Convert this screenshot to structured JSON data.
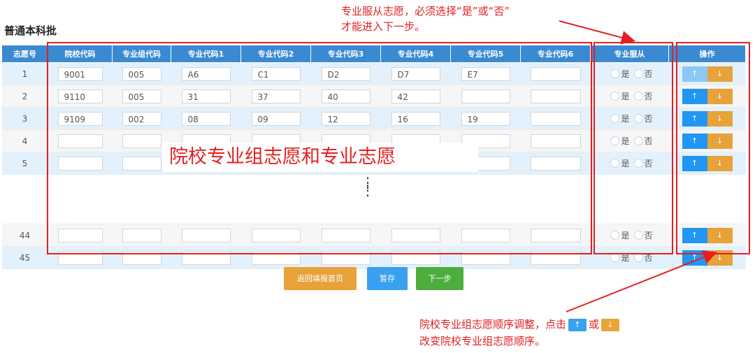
{
  "page": {
    "title": "普通本科批"
  },
  "annotations": {
    "top_line1": "专业服从志愿，必须选择“是”或“否”",
    "top_line2": "才能进入下一步。",
    "bottom_line1_part1": "院校专业组志愿顺序调整，点击",
    "bottom_line1_part2": "或",
    "bottom_line2": "改变院校专业组志愿顺序。",
    "overlay": "院校专业组志愿和专业志愿",
    "ellipsis": "⋮"
  },
  "table": {
    "headers": [
      "志愿号",
      "院校代码",
      "专业组代码",
      "专业代码1",
      "专业代码2",
      "专业代码3",
      "专业代码4",
      "专业代码5",
      "专业代码6",
      "专业服从",
      "操作"
    ],
    "rows": [
      {
        "no": "1",
        "cells": [
          "9001",
          "005",
          "A6",
          "C1",
          "D2",
          "D7",
          "E7",
          ""
        ]
      },
      {
        "no": "2",
        "cells": [
          "9110",
          "005",
          "31",
          "37",
          "40",
          "42",
          "",
          ""
        ]
      },
      {
        "no": "3",
        "cells": [
          "9109",
          "002",
          "08",
          "09",
          "12",
          "16",
          "19",
          ""
        ]
      },
      {
        "no": "4",
        "cells": [
          "",
          "",
          "",
          "",
          "",
          "",
          "",
          ""
        ]
      },
      {
        "no": "5",
        "cells": [
          "",
          "",
          "",
          "",
          "",
          "",
          "",
          ""
        ]
      },
      {
        "no": "44",
        "cells": [
          "",
          "",
          "",
          "",
          "",
          "",
          "",
          ""
        ]
      },
      {
        "no": "45",
        "cells": [
          "",
          "",
          "",
          "",
          "",
          "",
          "",
          ""
        ]
      }
    ],
    "radio_yes": "是",
    "radio_no": "否",
    "up_symbol": "↑",
    "down_symbol": "↓"
  },
  "actions": {
    "back_label": "返回填报首页",
    "save_label": "暂存",
    "next_label": "下一步"
  },
  "colors": {
    "header": "#3a8ad2",
    "up": "#2196f3",
    "down": "#e8a23a",
    "next": "#4cae3c",
    "annotation": "#e41f1f"
  },
  "icons": {
    "up": "arrow-up-icon",
    "down": "arrow-down-icon"
  }
}
